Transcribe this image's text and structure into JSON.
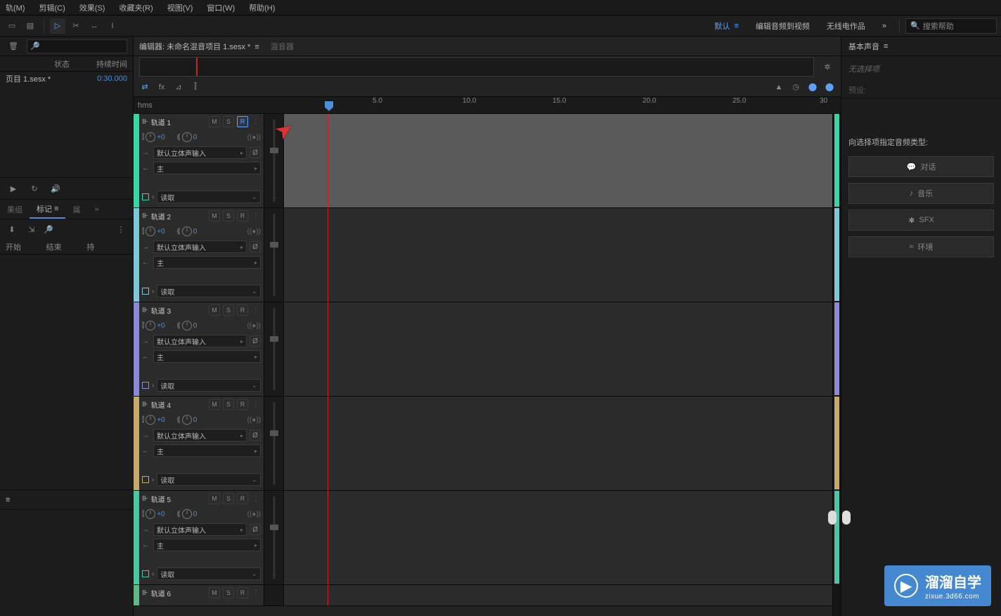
{
  "menu": [
    "轨(M)",
    "剪辑(C)",
    "效果(S)",
    "收藏夹(R)",
    "视图(V)",
    "窗口(W)",
    "帮助(H)"
  ],
  "workspaces": {
    "active": "默认",
    "items": [
      "默认",
      "编辑音频到视频",
      "无线电作品"
    ],
    "more": "»"
  },
  "search_placeholder": "搜索帮助",
  "files_panel": {
    "col_status": "状态",
    "col_duration": "持续时间",
    "file_name": "页目 1.sesx *",
    "file_dur": "0:30.000"
  },
  "tabs": {
    "group": "果组",
    "markers": "标记",
    "props": "属"
  },
  "markers": {
    "col_start": "开始",
    "col_end": "结束",
    "col_hold": "持"
  },
  "editor": {
    "tab_editor": "编辑器:",
    "doc": "未命名混音项目 1.sesx *",
    "tab_mixer": "混音器",
    "ruler_unit": "hms",
    "ticks": [
      "5.0",
      "10.0",
      "15.0",
      "20.0",
      "25.0",
      "30"
    ]
  },
  "track_labels": {
    "vol": "+0",
    "pan": "0",
    "input": "默认立体声输入",
    "output": "主",
    "read": "读取"
  },
  "tracks": [
    {
      "name": "轨道 1",
      "armed": true,
      "color": "#35d8a5",
      "rec": true,
      "meter": "#35d8a5"
    },
    {
      "name": "轨道 2",
      "armed": false,
      "color": "#7cc7d8",
      "rec": false,
      "meter": "#7cc7d8"
    },
    {
      "name": "轨道 3",
      "armed": false,
      "color": "#8c8ad8",
      "rec": false,
      "meter": "#8c8ad8"
    },
    {
      "name": "轨道 4",
      "armed": false,
      "color": "#c7aa6a",
      "rec": false,
      "meter": "#c7aa6a"
    },
    {
      "name": "轨道 5",
      "armed": false,
      "color": "#49c7a2",
      "rec": false,
      "meter": "#49c7a2"
    },
    {
      "name": "轨道 6",
      "armed": false,
      "color": "#5fb885",
      "rec": false,
      "meter": "#5fb885"
    }
  ],
  "essential_sound": {
    "title": "基本声音",
    "no_sel": "无选择项",
    "preset": "预设:",
    "assign": "向选择项指定音频类型:",
    "btns": [
      {
        "icon": "💬",
        "label": "对话"
      },
      {
        "icon": "♪",
        "label": "音乐"
      },
      {
        "icon": "✱",
        "label": "SFX"
      },
      {
        "icon": "≈",
        "label": "环境"
      }
    ]
  },
  "watermark": {
    "brand": "溜溜自学",
    "url": "zixue.3d66.com"
  }
}
